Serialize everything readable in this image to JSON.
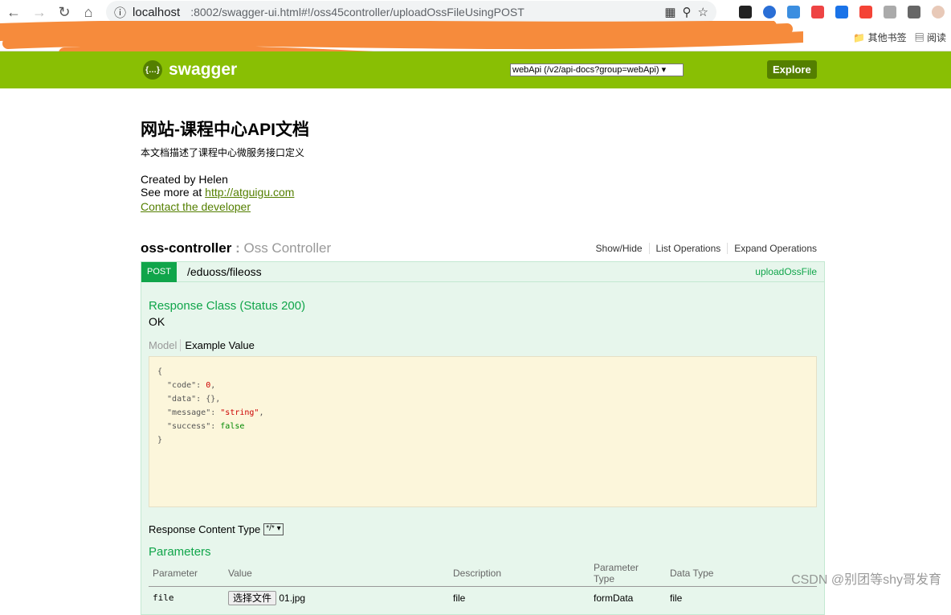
{
  "browser": {
    "url_host": "localhost",
    "url_path": ":8002/swagger-ui.html#!/oss45controller/uploadOssFileUsingPOST",
    "bookmarks": [
      "其他书签",
      "阅读"
    ]
  },
  "header": {
    "logo": "swagger",
    "api_select": "webApi (/v2/api-docs?group=webApi)",
    "explore": "Explore",
    "color": "#89bf04"
  },
  "info": {
    "title": "网站-课程中心API文档",
    "description": "本文档描述了课程中心微服务接口定义",
    "created_by": "Created by Helen",
    "see_more_prefix": "See more at ",
    "see_more_link": "http://atguigu.com",
    "contact": "Contact the developer"
  },
  "controller": {
    "name": "oss-controller",
    "sep": " : ",
    "desc": "Oss Controller",
    "links": [
      "Show/Hide",
      "List Operations",
      "Expand Operations"
    ]
  },
  "operation": {
    "method": "POST",
    "path": "/eduoss/fileoss",
    "nickname": "uploadOssFile",
    "response_class": "Response Class (Status 200)",
    "response_text": "OK",
    "tab_model": "Model",
    "tab_example": "Example Value",
    "example": {
      "code": "0",
      "data": "{}",
      "message": "\"string\"",
      "success": "false"
    },
    "response_content_type_label": "Response Content Type",
    "response_content_type": "*/*",
    "parameters_title": "Parameters",
    "param_headers": [
      "Parameter",
      "Value",
      "Description",
      "Parameter Type",
      "Data Type"
    ],
    "params": [
      {
        "name": "file",
        "button": "选择文件",
        "file": "01.jpg",
        "description": "file",
        "param_type": "formData",
        "data_type": "file"
      }
    ]
  },
  "watermark": "CSDN @别团等shy哥发育"
}
